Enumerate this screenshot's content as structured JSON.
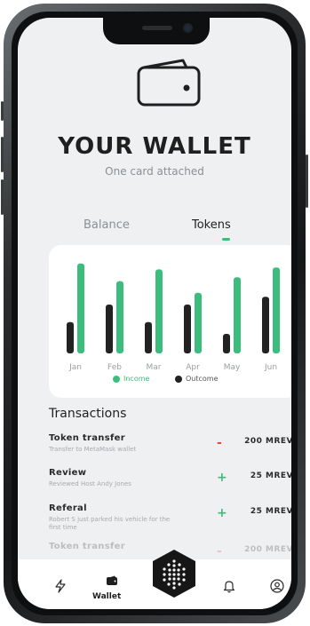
{
  "header": {
    "title": "YOUR WALLET",
    "subtitle": "One card attached"
  },
  "tabs": [
    {
      "label": "Balance",
      "active": false
    },
    {
      "label": "Tokens",
      "active": true
    }
  ],
  "colors": {
    "accent": "#3dbd7d",
    "outcome": "#222222",
    "negative": "#e5473d"
  },
  "chart_data": {
    "type": "bar",
    "categories": [
      "Jan",
      "Feb",
      "Mar",
      "Apr",
      "May",
      "Jun"
    ],
    "series": [
      {
        "name": "Outcome",
        "values": [
          32,
          50,
          32,
          50,
          20,
          58
        ]
      },
      {
        "name": "Income",
        "values": [
          92,
          74,
          86,
          62,
          78,
          88
        ]
      }
    ],
    "ylim": [
      0,
      100
    ],
    "grid": false,
    "legend": "bottom-center"
  },
  "transactions": {
    "title": "Transactions",
    "items": [
      {
        "name": "Token transfer",
        "desc": "Transfer to MetaMask wallet",
        "sign": "-",
        "amount": "200 MREV"
      },
      {
        "name": "Review",
        "desc": "Reviewed Host Andy Jones",
        "sign": "+",
        "amount": "25 MREV"
      },
      {
        "name": "Referal",
        "desc": "Robert S just parked his vehicle for the first time",
        "sign": "+",
        "amount": "25 MREV"
      },
      {
        "name": "Token transfer",
        "desc": "",
        "sign": "-",
        "amount": "200 MREV"
      }
    ]
  },
  "nav": {
    "items": [
      {
        "icon": "bolt-icon"
      },
      {
        "icon": "wallet-icon",
        "label": "Wallet"
      },
      {
        "icon": "hexagon-dots-icon"
      },
      {
        "icon": "bell-icon"
      },
      {
        "icon": "user-icon"
      }
    ]
  }
}
